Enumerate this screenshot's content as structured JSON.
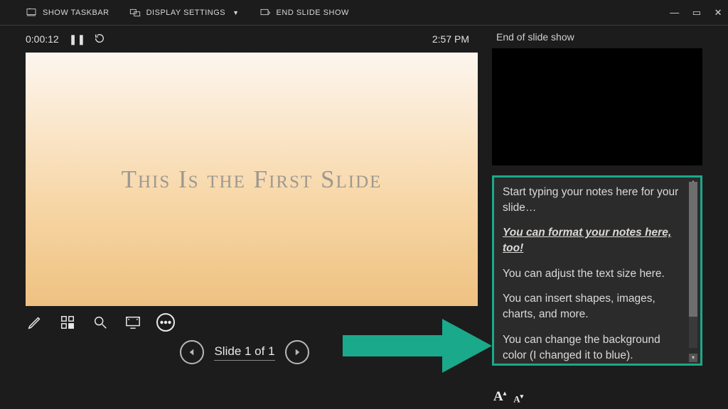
{
  "toolbar": {
    "show_taskbar": "SHOW TASKBAR",
    "display_settings": "DISPLAY SETTINGS",
    "end_slideshow": "END SLIDE SHOW"
  },
  "window_controls": {
    "minimize": "—",
    "maximize": "▭",
    "close": "✕"
  },
  "timer": {
    "elapsed": "0:00:12",
    "clock": "2:57 PM"
  },
  "slide": {
    "title": "This Is the First Slide"
  },
  "nav": {
    "counter": "Slide 1 of 1"
  },
  "next_panel": {
    "label": "End of slide show"
  },
  "notes": {
    "line1": "Start typing your notes here for your slide…",
    "line2": "You can format your notes here, too!",
    "line3": "You can adjust the text size here.",
    "line4": "You can insert shapes, images, charts, and more.",
    "line5": "You can change the background color (I changed it to blue)."
  }
}
